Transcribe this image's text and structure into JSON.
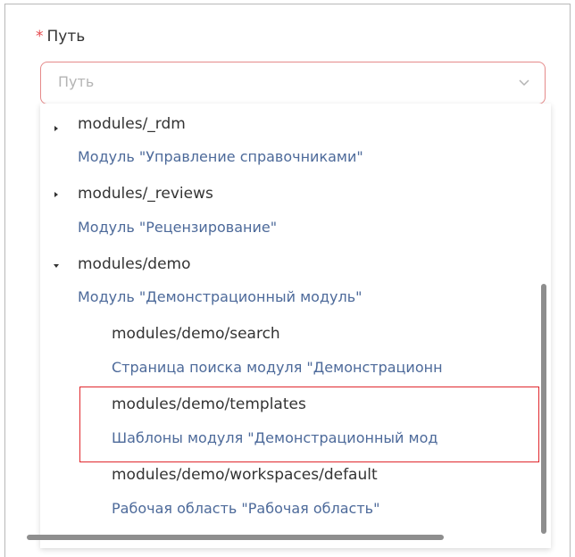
{
  "field": {
    "required_mark": "*",
    "label": "Путь",
    "placeholder": "Путь"
  },
  "icons": {
    "dropdown": "chevron-down-icon",
    "collapsed": "caret-right-icon",
    "expanded": "caret-down-icon"
  },
  "colors": {
    "path_text": "#333333",
    "description_text": "#4d6a9a",
    "error_border": "#e58a8a",
    "highlight": "#e0282d"
  },
  "tree": {
    "rdm": {
      "path": "modules/_rdm",
      "description": "Модуль \"Управление справочниками\"",
      "state": "collapsed"
    },
    "reviews": {
      "path": "modules/_reviews",
      "description": "Модуль \"Рецензирование\"",
      "state": "collapsed"
    },
    "demo": {
      "path": "modules/demo",
      "description": "Модуль \"Демонстрационный модуль\"",
      "state": "expanded"
    },
    "demo_search": {
      "path": "modules/demo/search",
      "description": "Страница поиска модуля \"Демонстрационн"
    },
    "demo_templates": {
      "path": "modules/demo/templates",
      "description": "Шаблоны модуля \"Демонстрационный мод"
    },
    "demo_workspaces": {
      "path": "modules/demo/workspaces/default",
      "description": "Рабочая область \"Рабочая область\""
    }
  }
}
